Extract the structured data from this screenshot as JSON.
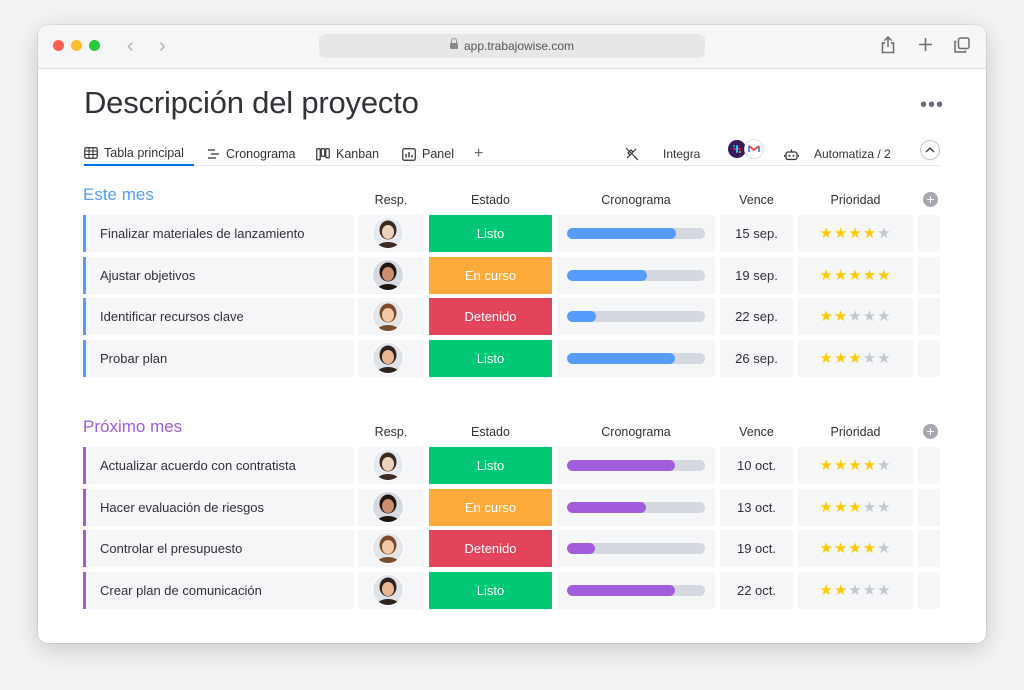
{
  "browser": {
    "url": "app.trabajowise.com"
  },
  "page": {
    "title": "Descripción del proyecto"
  },
  "views": {
    "tabs": [
      {
        "label": "Tabla principal",
        "icon": "table-icon",
        "active": true
      },
      {
        "label": "Cronograma",
        "icon": "timeline-icon",
        "active": false
      },
      {
        "label": "Kanban",
        "icon": "kanban-icon",
        "active": false
      },
      {
        "label": "Panel",
        "icon": "chart-icon",
        "active": false
      }
    ],
    "add_label": "+",
    "integrate_label": "Integra",
    "automate_label": "Automatiza / 2"
  },
  "columns": {
    "resp": "Resp.",
    "status": "Estado",
    "timeline": "Cronograma",
    "due": "Vence",
    "priority": "Prioridad"
  },
  "colors": {
    "status_done": "#00c875",
    "status_working": "#fdab3d",
    "status_stuck": "#e2445c",
    "group1": "#579bfc",
    "group2": "#a25ddc"
  },
  "groups": [
    {
      "title": "Este mes",
      "color": "#579bfc",
      "rows": [
        {
          "name": "Finalizar materiales de lanzamiento",
          "status": "Listo",
          "status_kind": "done",
          "progress": 0.79,
          "due": "15 sep.",
          "stars": 4
        },
        {
          "name": "Ajustar objetivos",
          "status": "En curso",
          "status_kind": "working",
          "progress": 0.58,
          "due": "19 sep.",
          "stars": 5
        },
        {
          "name": "Identificar recursos clave",
          "status": "Detenido",
          "status_kind": "stuck",
          "progress": 0.21,
          "due": "22 sep.",
          "stars": 2
        },
        {
          "name": "Probar plan",
          "status": "Listo",
          "status_kind": "done",
          "progress": 0.78,
          "due": "26 sep.",
          "stars": 3
        }
      ]
    },
    {
      "title": "Próximo mes",
      "color": "#a25ddc",
      "rows": [
        {
          "name": "Actualizar acuerdo con contratista",
          "status": "Listo",
          "status_kind": "done",
          "progress": 0.78,
          "due": "10 oct.",
          "stars": 4
        },
        {
          "name": "Hacer evaluación de riesgos",
          "status": "En curso",
          "status_kind": "working",
          "progress": 0.57,
          "due": "13 oct.",
          "stars": 3
        },
        {
          "name": "Controlar el presupuesto",
          "status": "Detenido",
          "status_kind": "stuck",
          "progress": 0.2,
          "due": "19 oct.",
          "stars": 4
        },
        {
          "name": "Crear plan de comunicación",
          "status": "Listo",
          "status_kind": "done",
          "progress": 0.78,
          "due": "22 oct.",
          "stars": 2
        }
      ]
    }
  ],
  "stars_max": 5
}
